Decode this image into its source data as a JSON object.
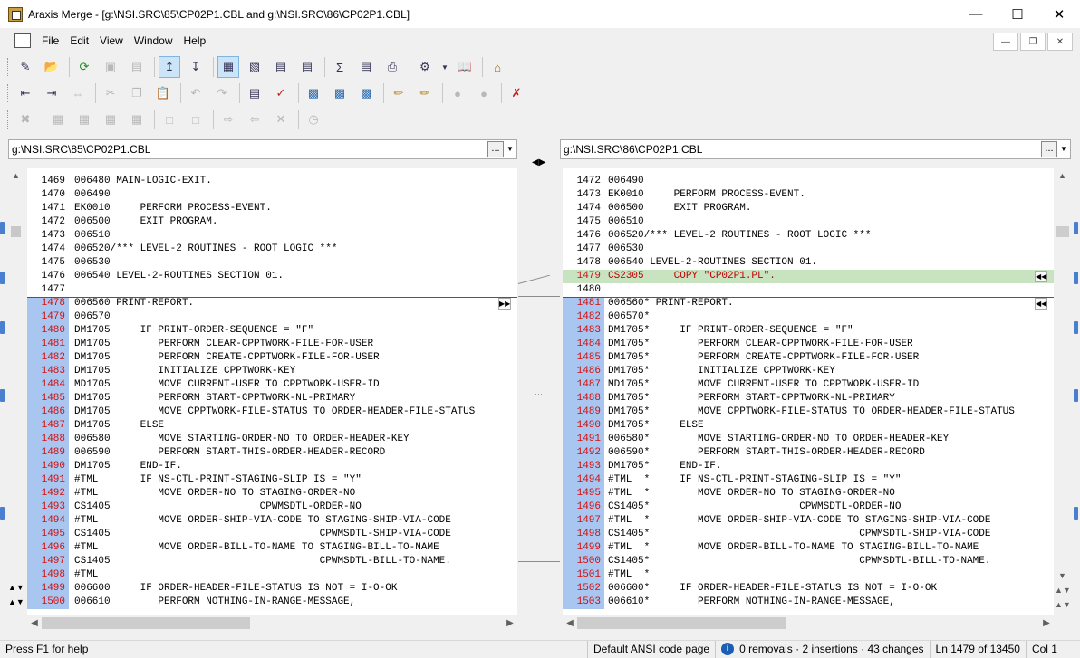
{
  "window": {
    "title": "Araxis Merge - [g:\\NSI.SRC\\85\\CP02P1.CBL and g:\\NSI.SRC\\86\\CP02P1.CBL]"
  },
  "menu": [
    "File",
    "Edit",
    "View",
    "Window",
    "Help"
  ],
  "left_path": "g:\\NSI.SRC\\85\\CP02P1.CBL",
  "right_path": "g:\\NSI.SRC\\86\\CP02P1.CBL",
  "path_button": "...",
  "left_lines": [
    {
      "n": "1469",
      "c": "006480 MAIN-LOGIC-EXIT.",
      "t": "n"
    },
    {
      "n": "1470",
      "c": "006490",
      "t": "n"
    },
    {
      "n": "1471",
      "c": "EK0010     PERFORM PROCESS-EVENT.",
      "t": "n"
    },
    {
      "n": "1472",
      "c": "006500     EXIT PROGRAM.",
      "t": "n"
    },
    {
      "n": "1473",
      "c": "006510",
      "t": "n"
    },
    {
      "n": "1474",
      "c": "006520/*** LEVEL-2 ROUTINES - ROOT LOGIC ***",
      "t": "n"
    },
    {
      "n": "1475",
      "c": "006530",
      "t": "n"
    },
    {
      "n": "1476",
      "c": "006540 LEVEL-2-ROUTINES SECTION 01.",
      "t": "n"
    },
    {
      "n": "1477",
      "c": "",
      "t": "n"
    },
    {
      "n": "1478",
      "c": "006560 PRINT-REPORT.",
      "t": "c"
    },
    {
      "n": "1479",
      "c": "006570",
      "t": "c"
    },
    {
      "n": "1480",
      "c": "DM1705     IF PRINT-ORDER-SEQUENCE = \"F\"",
      "t": "c"
    },
    {
      "n": "1481",
      "c": "DM1705        PERFORM CLEAR-CPPTWORK-FILE-FOR-USER",
      "t": "c"
    },
    {
      "n": "1482",
      "c": "DM1705        PERFORM CREATE-CPPTWORK-FILE-FOR-USER",
      "t": "c"
    },
    {
      "n": "1483",
      "c": "DM1705        INITIALIZE CPPTWORK-KEY",
      "t": "c"
    },
    {
      "n": "1484",
      "c": "MD1705        MOVE CURRENT-USER TO CPPTWORK-USER-ID",
      "t": "c"
    },
    {
      "n": "1485",
      "c": "DM1705        PERFORM START-CPPTWORK-NL-PRIMARY",
      "t": "c"
    },
    {
      "n": "1486",
      "c": "DM1705        MOVE CPPTWORK-FILE-STATUS TO ORDER-HEADER-FILE-STATUS",
      "t": "c"
    },
    {
      "n": "1487",
      "c": "DM1705     ELSE",
      "t": "c"
    },
    {
      "n": "1488",
      "c": "006580        MOVE STARTING-ORDER-NO TO ORDER-HEADER-KEY",
      "t": "c"
    },
    {
      "n": "1489",
      "c": "006590        PERFORM START-THIS-ORDER-HEADER-RECORD",
      "t": "c"
    },
    {
      "n": "1490",
      "c": "DM1705     END-IF.",
      "t": "c"
    },
    {
      "n": "1491",
      "c": "#TML       IF NS-CTL-PRINT-STAGING-SLIP IS = \"Y\"",
      "t": "c"
    },
    {
      "n": "1492",
      "c": "#TML          MOVE ORDER-NO TO STAGING-ORDER-NO",
      "t": "c"
    },
    {
      "n": "1493",
      "c": "CS1405                         CPWMSDTL-ORDER-NO",
      "t": "c"
    },
    {
      "n": "1494",
      "c": "#TML          MOVE ORDER-SHIP-VIA-CODE TO STAGING-SHIP-VIA-CODE",
      "t": "c"
    },
    {
      "n": "1495",
      "c": "CS1405                                   CPWMSDTL-SHIP-VIA-CODE",
      "t": "c"
    },
    {
      "n": "1496",
      "c": "#TML          MOVE ORDER-BILL-TO-NAME TO STAGING-BILL-TO-NAME",
      "t": "c"
    },
    {
      "n": "1497",
      "c": "CS1405                                   CPWMSDTL-BILL-TO-NAME.",
      "t": "c"
    },
    {
      "n": "1498",
      "c": "#TML",
      "t": "c"
    },
    {
      "n": "1499",
      "c": "006600     IF ORDER-HEADER-FILE-STATUS IS NOT = I-O-OK",
      "t": "c"
    },
    {
      "n": "1500",
      "c": "006610        PERFORM NOTHING-IN-RANGE-MESSAGE,",
      "t": "c"
    }
  ],
  "right_lines": [
    {
      "n": "1472",
      "c": "006490",
      "t": "n"
    },
    {
      "n": "1473",
      "c": "EK0010     PERFORM PROCESS-EVENT.",
      "t": "n"
    },
    {
      "n": "1474",
      "c": "006500     EXIT PROGRAM.",
      "t": "n"
    },
    {
      "n": "1475",
      "c": "006510",
      "t": "n"
    },
    {
      "n": "1476",
      "c": "006520/*** LEVEL-2 ROUTINES - ROOT LOGIC ***",
      "t": "n"
    },
    {
      "n": "1477",
      "c": "006530",
      "t": "n"
    },
    {
      "n": "1478",
      "c": "006540 LEVEL-2-ROUTINES SECTION 01.",
      "t": "n"
    },
    {
      "n": "1479",
      "c": "CS2305     COPY \"CP02P1.PL\".",
      "t": "i"
    },
    {
      "n": "1480",
      "c": "",
      "t": "n"
    },
    {
      "n": "1481",
      "c": "006560* PRINT-REPORT.",
      "t": "c"
    },
    {
      "n": "1482",
      "c": "006570*",
      "t": "c"
    },
    {
      "n": "1483",
      "c": "DM1705*     IF PRINT-ORDER-SEQUENCE = \"F\"",
      "t": "c"
    },
    {
      "n": "1484",
      "c": "DM1705*        PERFORM CLEAR-CPPTWORK-FILE-FOR-USER",
      "t": "c"
    },
    {
      "n": "1485",
      "c": "DM1705*        PERFORM CREATE-CPPTWORK-FILE-FOR-USER",
      "t": "c"
    },
    {
      "n": "1486",
      "c": "DM1705*        INITIALIZE CPPTWORK-KEY",
      "t": "c"
    },
    {
      "n": "1487",
      "c": "MD1705*        MOVE CURRENT-USER TO CPPTWORK-USER-ID",
      "t": "c"
    },
    {
      "n": "1488",
      "c": "DM1705*        PERFORM START-CPPTWORK-NL-PRIMARY",
      "t": "c"
    },
    {
      "n": "1489",
      "c": "DM1705*        MOVE CPPTWORK-FILE-STATUS TO ORDER-HEADER-FILE-STATUS",
      "t": "c"
    },
    {
      "n": "1490",
      "c": "DM1705*     ELSE",
      "t": "c"
    },
    {
      "n": "1491",
      "c": "006580*        MOVE STARTING-ORDER-NO TO ORDER-HEADER-KEY",
      "t": "c"
    },
    {
      "n": "1492",
      "c": "006590*        PERFORM START-THIS-ORDER-HEADER-RECORD",
      "t": "c"
    },
    {
      "n": "1493",
      "c": "DM1705*     END-IF.",
      "t": "c"
    },
    {
      "n": "1494",
      "c": "#TML  *     IF NS-CTL-PRINT-STAGING-SLIP IS = \"Y\"",
      "t": "c"
    },
    {
      "n": "1495",
      "c": "#TML  *        MOVE ORDER-NO TO STAGING-ORDER-NO",
      "t": "c"
    },
    {
      "n": "1496",
      "c": "CS1405*                         CPWMSDTL-ORDER-NO",
      "t": "c"
    },
    {
      "n": "1497",
      "c": "#TML  *        MOVE ORDER-SHIP-VIA-CODE TO STAGING-SHIP-VIA-CODE",
      "t": "c"
    },
    {
      "n": "1498",
      "c": "CS1405*                                   CPWMSDTL-SHIP-VIA-CODE",
      "t": "c"
    },
    {
      "n": "1499",
      "c": "#TML  *        MOVE ORDER-BILL-TO-NAME TO STAGING-BILL-TO-NAME",
      "t": "c"
    },
    {
      "n": "1500",
      "c": "CS1405*                                   CPWMSDTL-BILL-TO-NAME.",
      "t": "c"
    },
    {
      "n": "1501",
      "c": "#TML  *",
      "t": "c"
    },
    {
      "n": "1502",
      "c": "006600*     IF ORDER-HEADER-FILE-STATUS IS NOT = I-O-OK",
      "t": "c"
    },
    {
      "n": "1503",
      "c": "006610*        PERFORM NOTHING-IN-RANGE-MESSAGE,",
      "t": "c"
    }
  ],
  "status": {
    "help": "Press F1 for help",
    "encoding": "Default ANSI code page",
    "summary": "0 removals · 2 insertions · 43 changes",
    "position": "Ln 1479 of 13450",
    "column": "Col 1"
  },
  "colors": {
    "changed": "#a8c6f0",
    "inserted": "#c7e3c0",
    "line_number_changed": "#d01010"
  }
}
